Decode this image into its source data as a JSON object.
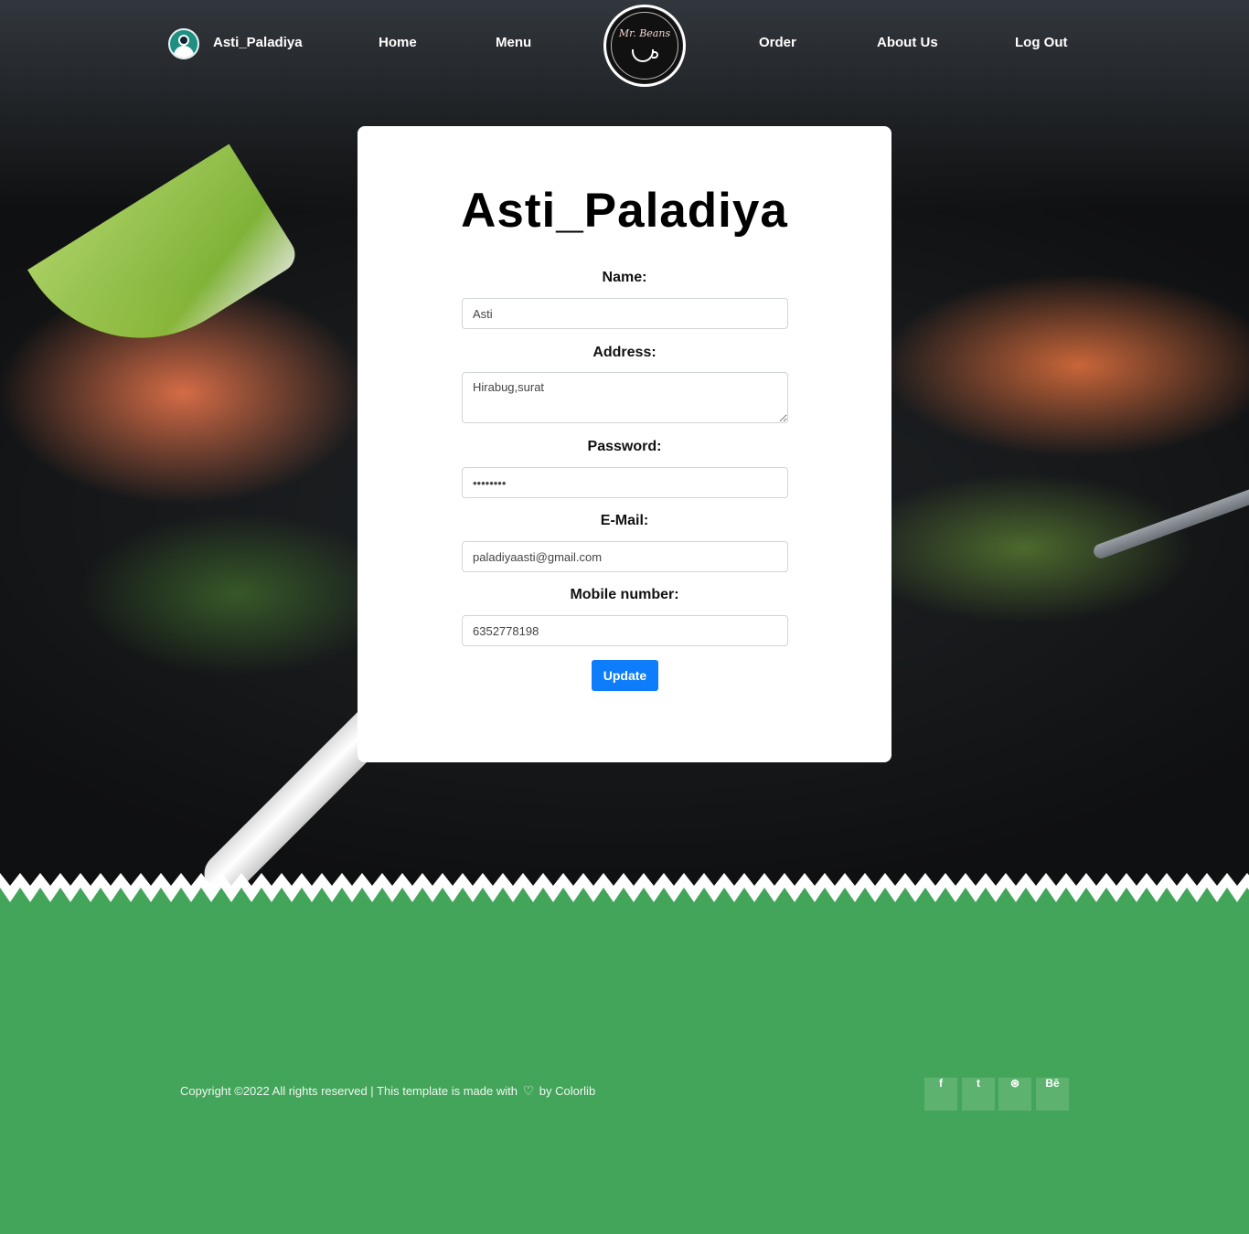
{
  "nav": {
    "profile_name": "Asti_Paladiya",
    "items": [
      "Home",
      "Menu",
      "Order",
      "About Us",
      "Log Out"
    ],
    "logo_text": "Mr. Beans"
  },
  "profile_form": {
    "title": "Asti_Paladiya",
    "fields": {
      "name": {
        "label": "Name:",
        "value": "Asti"
      },
      "address": {
        "label": "Address:",
        "value": "Hirabug,surat"
      },
      "password": {
        "label": "Password:",
        "value": "••••••••"
      },
      "email": {
        "label": "E-Mail:",
        "value": "paladiyaasti@gmail.com"
      },
      "mobile": {
        "label": "Mobile number:",
        "value": "6352778198"
      }
    },
    "update_label": "Update",
    "button_color": "#0d7dfb"
  },
  "footer": {
    "copyright_before": "Copyright ©2022 All rights reserved | This template is made with",
    "copyright_after": "by Colorlib",
    "social": [
      {
        "icon": "facebook-icon",
        "glyph": "f"
      },
      {
        "icon": "twitter-icon",
        "glyph": "t"
      },
      {
        "icon": "dribbble-icon",
        "glyph": "⊛"
      },
      {
        "icon": "behance-icon",
        "glyph": "Bē"
      }
    ],
    "background_color": "#43a55a"
  }
}
